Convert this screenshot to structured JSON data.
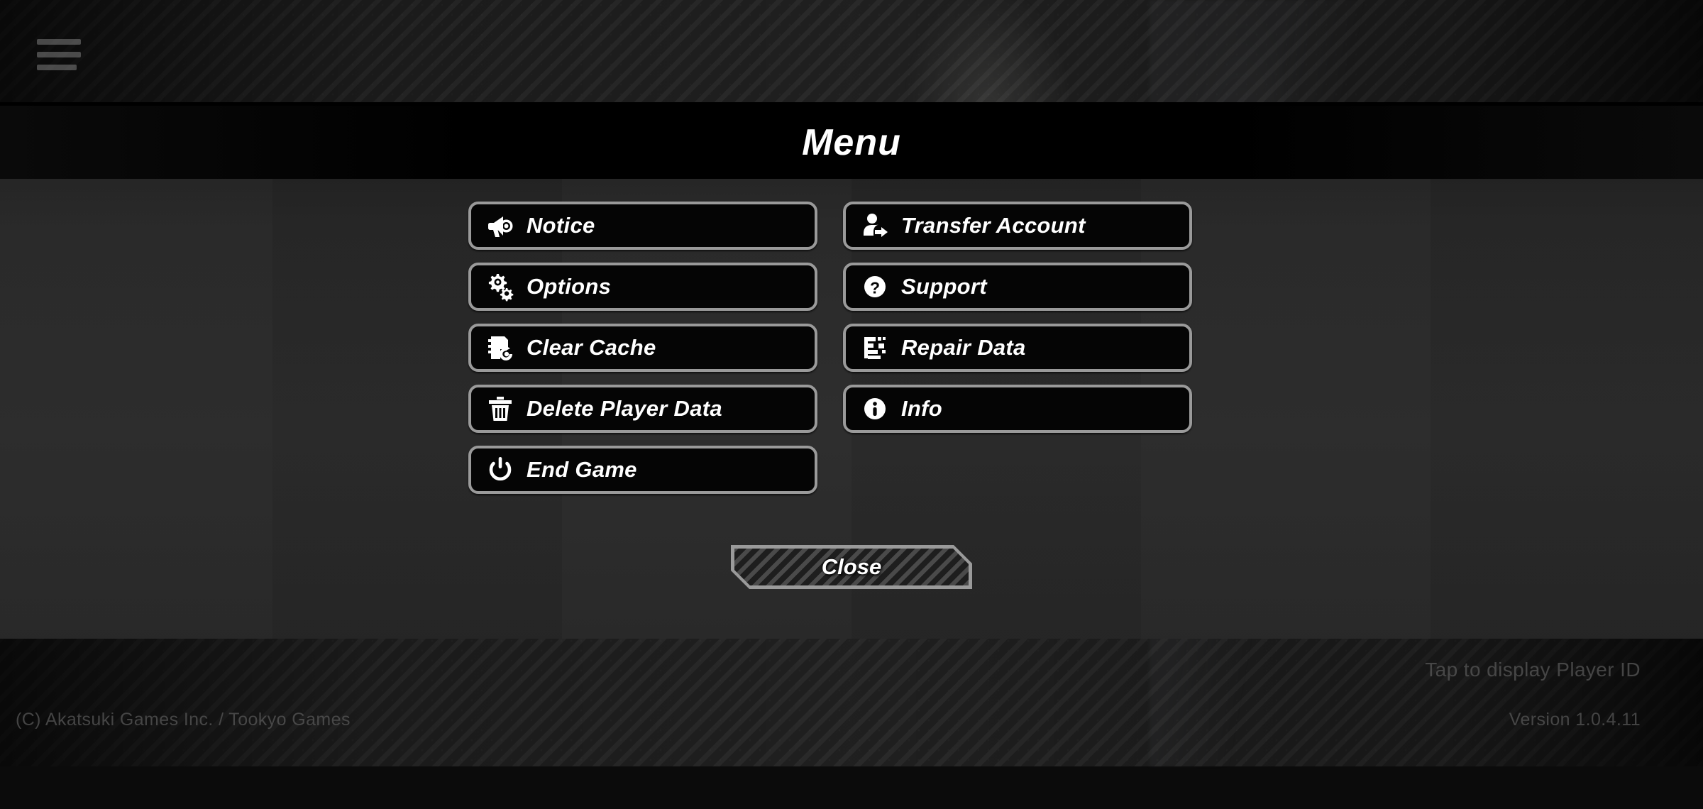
{
  "app": {
    "title": "Menu",
    "copyright": "(C) Akatsuki Games Inc. / Tookyo Games",
    "version": "Version 1.0.4.11",
    "player_id_hint": "Tap to display Player ID"
  },
  "colors": {
    "button_border": "#9a9a9a",
    "button_fill": "#050505",
    "panel_body": "#2a2a2a",
    "title_bar": "#000000",
    "text": "#ffffff",
    "dim_text": "#5a5a5a"
  },
  "topbar": {
    "menu_icon": "hamburger-icon"
  },
  "menu": {
    "items": [
      {
        "label": "Notice",
        "icon": "megaphone-icon",
        "column": "left"
      },
      {
        "label": "Transfer Account",
        "icon": "person-transfer-icon",
        "column": "right"
      },
      {
        "label": "Options",
        "icon": "gears-icon",
        "column": "left"
      },
      {
        "label": "Support",
        "icon": "question-circle-icon",
        "column": "right"
      },
      {
        "label": "Clear Cache",
        "icon": "document-refresh-icon",
        "column": "left"
      },
      {
        "label": "Repair Data",
        "icon": "fragmented-data-icon",
        "column": "right"
      },
      {
        "label": "Delete Player Data",
        "icon": "trash-icon",
        "column": "left"
      },
      {
        "label": "Info",
        "icon": "info-circle-icon",
        "column": "right"
      },
      {
        "label": "End Game",
        "icon": "power-icon",
        "column": "left"
      }
    ],
    "close_label": "Close"
  }
}
